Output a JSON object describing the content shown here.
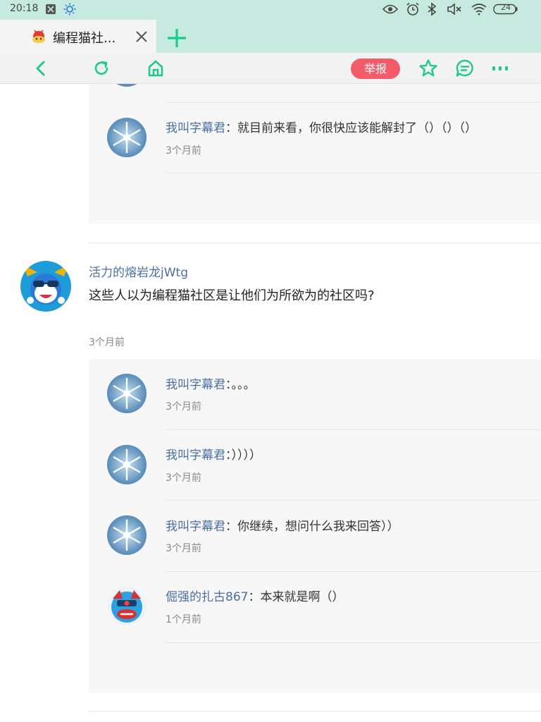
{
  "status_bar": {
    "time": "20:18",
    "battery": "24",
    "icons": [
      "scissors-icon",
      "sun-icon",
      "eye-icon",
      "alarm-icon",
      "bluetooth-icon",
      "mute-icon",
      "wifi-icon",
      "battery-icon"
    ]
  },
  "tab": {
    "title": "编程猫社...",
    "favicon": "codemao-logo-icon"
  },
  "toolbar": {
    "report_label": "举报",
    "accent_color": "#1ec98f",
    "report_color": "#f45b69"
  },
  "thread_top": {
    "replies": [
      {
        "name": "我叫字幕君",
        "sep": "：",
        "text": "就目前来看，你很快应该能解封了（）（）（）",
        "time": "3个月前"
      }
    ]
  },
  "comment": {
    "name": "活力的熔岩龙jWtg",
    "text": "这些人以为编程猫社区是让他们为所欲为的社区吗?",
    "time": "3个月前",
    "replies": [
      {
        "name": "我叫字幕君",
        "sep": "：",
        "text": "。。。",
        "time": "3个月前"
      },
      {
        "name": "我叫字幕君",
        "sep": "：",
        "text": "））））",
        "time": "3个月前"
      },
      {
        "name": "我叫字幕君",
        "sep": "：",
        "text": "你继续，想问什么我来回答））",
        "time": "3个月前"
      },
      {
        "name": "倔强的扎古867",
        "sep": "：",
        "text": "本来就是啊（）",
        "time": "1个月前"
      }
    ]
  }
}
